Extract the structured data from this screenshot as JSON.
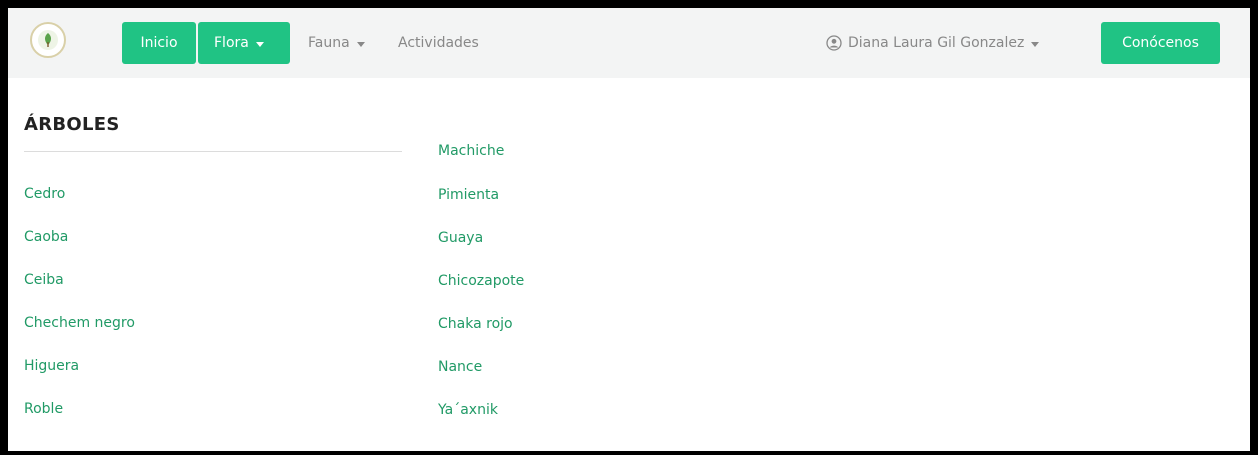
{
  "nav": {
    "logo_icon": "leaf-logo-icon",
    "inicio": "Inicio",
    "flora": "Flora",
    "fauna": "Fauna",
    "actividades": "Actividades",
    "user_name": "Diana Laura Gil Gonzalez",
    "cta": "Conócenos"
  },
  "section": {
    "title": "ÁRBOLES"
  },
  "left_items": [
    "Cedro",
    "Caoba",
    "Ceiba",
    "Chechem negro",
    "Higuera",
    "Roble"
  ],
  "right_items": [
    "Machiche",
    "Pimienta",
    "Guaya",
    "Chicozapote",
    "Chaka rojo",
    "Nance",
    "Ya´axnik"
  ],
  "colors": {
    "accent": "#20c384",
    "link": "#219a66",
    "navbar_bg": "#f3f4f4"
  }
}
